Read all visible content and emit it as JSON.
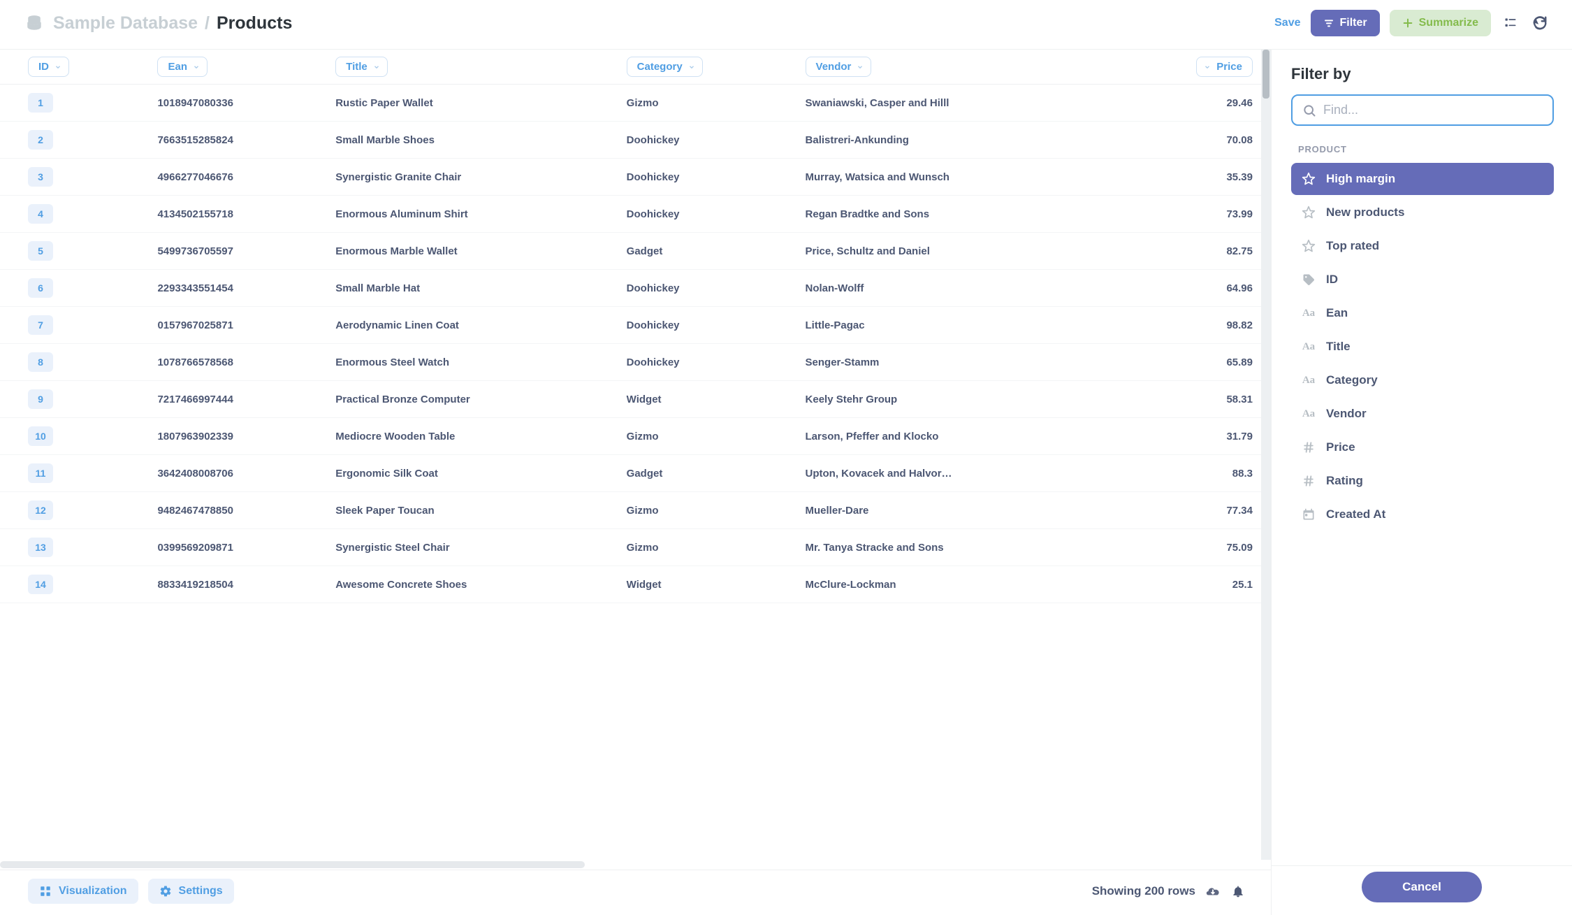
{
  "header": {
    "breadcrumb_db": "Sample Database",
    "breadcrumb_sep": "/",
    "breadcrumb_current": "Products",
    "save_label": "Save",
    "filter_label": "Filter",
    "summarize_label": "Summarize"
  },
  "table": {
    "columns": [
      "ID",
      "Ean",
      "Title",
      "Category",
      "Vendor",
      "Price"
    ],
    "rows": [
      {
        "id": 1,
        "ean": "1018947080336",
        "title": "Rustic Paper Wallet",
        "category": "Gizmo",
        "vendor": "Swaniawski, Casper and Hilll",
        "price": "29.46"
      },
      {
        "id": 2,
        "ean": "7663515285824",
        "title": "Small Marble Shoes",
        "category": "Doohickey",
        "vendor": "Balistreri-Ankunding",
        "price": "70.08"
      },
      {
        "id": 3,
        "ean": "4966277046676",
        "title": "Synergistic Granite Chair",
        "category": "Doohickey",
        "vendor": "Murray, Watsica and Wunsch",
        "price": "35.39"
      },
      {
        "id": 4,
        "ean": "4134502155718",
        "title": "Enormous Aluminum Shirt",
        "category": "Doohickey",
        "vendor": "Regan Bradtke and Sons",
        "price": "73.99"
      },
      {
        "id": 5,
        "ean": "5499736705597",
        "title": "Enormous Marble Wallet",
        "category": "Gadget",
        "vendor": "Price, Schultz and Daniel",
        "price": "82.75"
      },
      {
        "id": 6,
        "ean": "2293343551454",
        "title": "Small Marble Hat",
        "category": "Doohickey",
        "vendor": "Nolan-Wolff",
        "price": "64.96"
      },
      {
        "id": 7,
        "ean": "0157967025871",
        "title": "Aerodynamic Linen Coat",
        "category": "Doohickey",
        "vendor": "Little-Pagac",
        "price": "98.82"
      },
      {
        "id": 8,
        "ean": "1078766578568",
        "title": "Enormous Steel Watch",
        "category": "Doohickey",
        "vendor": "Senger-Stamm",
        "price": "65.89"
      },
      {
        "id": 9,
        "ean": "7217466997444",
        "title": "Practical Bronze Computer",
        "category": "Widget",
        "vendor": "Keely Stehr Group",
        "price": "58.31"
      },
      {
        "id": 10,
        "ean": "1807963902339",
        "title": "Mediocre Wooden Table",
        "category": "Gizmo",
        "vendor": "Larson, Pfeffer and Klocko",
        "price": "31.79"
      },
      {
        "id": 11,
        "ean": "3642408008706",
        "title": "Ergonomic Silk Coat",
        "category": "Gadget",
        "vendor": "Upton, Kovacek and Halvor…",
        "price": "88.3"
      },
      {
        "id": 12,
        "ean": "9482467478850",
        "title": "Sleek Paper Toucan",
        "category": "Gizmo",
        "vendor": "Mueller-Dare",
        "price": "77.34"
      },
      {
        "id": 13,
        "ean": "0399569209871",
        "title": "Synergistic Steel Chair",
        "category": "Gizmo",
        "vendor": "Mr. Tanya Stracke and Sons",
        "price": "75.09"
      },
      {
        "id": 14,
        "ean": "8833419218504",
        "title": "Awesome Concrete Shoes",
        "category": "Widget",
        "vendor": "McClure-Lockman",
        "price": "25.1"
      }
    ]
  },
  "footer": {
    "visualization_label": "Visualization",
    "settings_label": "Settings",
    "status_text": "Showing 200 rows"
  },
  "filter_panel": {
    "title": "Filter by",
    "find_placeholder": "Find...",
    "section_label": "PRODUCT",
    "items": [
      {
        "icon": "star",
        "label": "High margin",
        "selected": true
      },
      {
        "icon": "star",
        "label": "New products",
        "selected": false
      },
      {
        "icon": "star",
        "label": "Top rated",
        "selected": false
      },
      {
        "icon": "tag",
        "label": "ID",
        "selected": false
      },
      {
        "icon": "aa",
        "label": "Ean",
        "selected": false
      },
      {
        "icon": "aa",
        "label": "Title",
        "selected": false
      },
      {
        "icon": "aa",
        "label": "Category",
        "selected": false
      },
      {
        "icon": "aa",
        "label": "Vendor",
        "selected": false
      },
      {
        "icon": "hash",
        "label": "Price",
        "selected": false
      },
      {
        "icon": "hash",
        "label": "Rating",
        "selected": false
      },
      {
        "icon": "cal",
        "label": "Created At",
        "selected": false
      }
    ],
    "cancel_label": "Cancel"
  }
}
